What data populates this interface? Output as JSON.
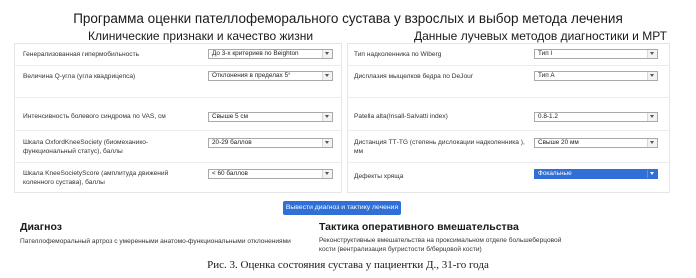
{
  "title": "Программа оценки пателлофеморального сустава у взрослых и выбор метода лечения",
  "left_section": {
    "title": "Клинические признаки и качество жизни",
    "fields": [
      {
        "label": "Генерализованная гипермобильность",
        "value": "До 3-х критериев по Beighton"
      },
      {
        "label": "Величина Q-угла (угла квадрицепса)",
        "value": "Отклонения в пределах 5°"
      },
      {
        "label": "Интенсивность болевого синдрома по VAS, см",
        "value": "Свыше 5 см"
      },
      {
        "label_line1": "Шкала OxfordKneeSociety (биомеханико-",
        "label_line2": "функциональный статус), баллы",
        "value": "20-29 баллов"
      },
      {
        "label_line1": "Шкала KneeSocietyScore (амплитуда движений",
        "label_line2": "коленного сустава), баллы",
        "value": "< 60 баллов"
      }
    ]
  },
  "right_section": {
    "title": "Данные лучевых методов диагностики и МРТ",
    "fields": [
      {
        "label": "Тип надколенника по Wiberg",
        "value": "Тип I"
      },
      {
        "label": "Дисплазия мыщелков бедра по DeJour",
        "value": "Тип А"
      },
      {
        "label": "Patella alta(Insall-Salvatti index)",
        "value": "0.8-1.2"
      },
      {
        "label_line1": "Дистанция ТТ-TG (степень дислокации надколенника ),",
        "label_line2": "мм",
        "value": "Свыше 20 мм"
      },
      {
        "label": "Дефекты хряща",
        "value": "Фокальные"
      }
    ]
  },
  "action_button": "Вывести диагноз и тактику лечения",
  "diagnosis": {
    "heading": "Диагноз",
    "text": "Пателлофеморальный артроз с умеренными анатомо-функциональными отклонениями"
  },
  "tactics": {
    "heading": "Тактика оперативного вмешательства",
    "text_line1": "Реконструктивные вмешательства на проксимальном отделе большеберцовой",
    "text_line2": "кости (вентрализация бугристости б/берцовой кости)"
  },
  "caption": "Рис. 3. Оценка состояния сустава у пациентки Д., 31-го года",
  "colors": {
    "accent": "#2f6fd6",
    "selected_option_background": "#2f6fd6"
  }
}
